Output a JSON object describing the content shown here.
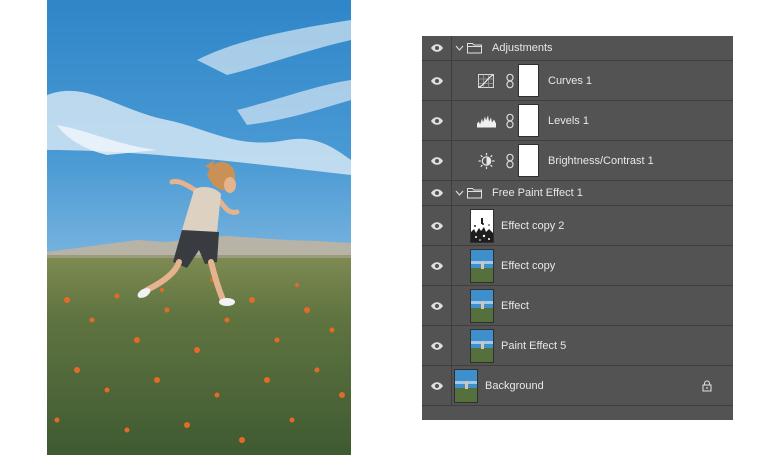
{
  "layers_panel": {
    "layers": [
      {
        "name": "Adjustments",
        "kind": "group",
        "visible": true,
        "expanded": true
      },
      {
        "name": "Curves 1",
        "kind": "adjustment",
        "icon": "curves-icon",
        "visible": true
      },
      {
        "name": "Levels 1",
        "kind": "adjustment",
        "icon": "levels-icon",
        "visible": true
      },
      {
        "name": "Brightness/Contrast 1",
        "kind": "adjustment",
        "icon": "brightness-contrast-icon",
        "visible": true
      },
      {
        "name": "Free Paint Effect 1",
        "kind": "group",
        "visible": true,
        "expanded": true
      },
      {
        "name": "Effect copy 2",
        "kind": "pixel",
        "thumbnail": "white-texture",
        "visible": true
      },
      {
        "name": "Effect copy",
        "kind": "pixel",
        "thumbnail": "photo",
        "visible": true
      },
      {
        "name": "Effect",
        "kind": "pixel",
        "thumbnail": "photo",
        "visible": true
      },
      {
        "name": "Paint Effect 5",
        "kind": "pixel",
        "thumbnail": "photo",
        "visible": true
      },
      {
        "name": "Background",
        "kind": "background",
        "thumbnail": "photo",
        "visible": true,
        "locked": true
      }
    ]
  },
  "colors": {
    "panel_bg": "#535353",
    "divider": "#3e3e3e",
    "text": "#e8e8e8",
    "page_bg": "#ffffff"
  }
}
